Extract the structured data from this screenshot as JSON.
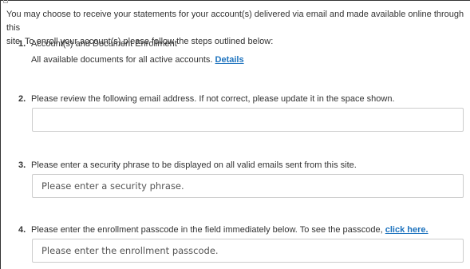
{
  "intro": {
    "line1": "You may choose to receive your statements for your account(s) delivered via email and made available online through this",
    "line2": "site. To enroll your account(s) please follow the steps outlined below:"
  },
  "steps": [
    {
      "number": "1.",
      "text": "Account(s) and Document Enrollment",
      "subtext": "All available documents for all active accounts.",
      "link": "Details"
    },
    {
      "number": "2.",
      "text": "Please review the following email address. If not correct, please update it in the space shown.",
      "input_value": "",
      "placeholder": ""
    },
    {
      "number": "3.",
      "text": "Please enter a security phrase to be displayed on all valid emails sent from this site.",
      "placeholder": "Please enter a security phrase."
    },
    {
      "number": "4.",
      "text": "Please enter the enrollment passcode in the field immediately below. To see the passcode,",
      "link": "click here.",
      "placeholder": "Please enter the enrollment passcode."
    }
  ]
}
